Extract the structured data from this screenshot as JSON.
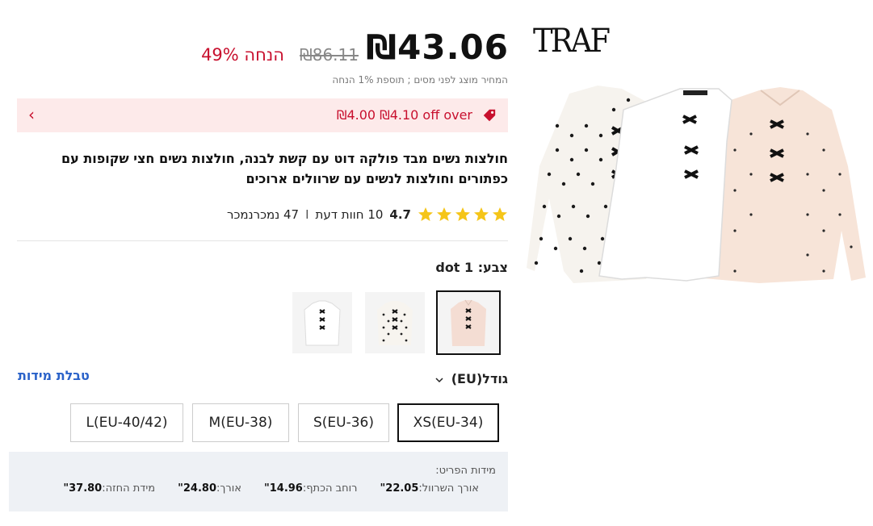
{
  "price": {
    "current": "₪43.06",
    "original": "₪86.11",
    "discount": "49% הנחה",
    "tax_note": "המחיר מוצג לפני מסים ; תוספת 1% הנחה"
  },
  "coupon": {
    "text": "₪4.00 ₪4.10 off over",
    "chevron": "‹"
  },
  "product": {
    "title": "חולצות נשים מבד פולקה דוט עם קשת לבנה, חולצות נשים חצי שקופות עם כפתורים וחולצות לנשים עם שרוולים ארוכים"
  },
  "rating": {
    "score": "4.7",
    "stars": 5,
    "reviews": "10 חוות דעת",
    "sold": "47 נמכרנמכר",
    "separator": "I"
  },
  "color": {
    "label": "צבע:",
    "value": "dot 1",
    "swatches": [
      "dot 1",
      "dot 2",
      "white"
    ]
  },
  "size": {
    "label": "גודל(EU)",
    "chart_link": "טבלת מידות",
    "options": [
      "XS(EU-34)",
      "S(EU-36)",
      "M(EU-38)",
      "L(EU-40/42)"
    ],
    "selected": "XS(EU-34)"
  },
  "measurements": {
    "heading": "מידות הפריט:",
    "items": [
      {
        "label": "מידת החזה:",
        "value": "37.80\""
      },
      {
        "label": "אורך:",
        "value": "24.80\""
      },
      {
        "label": "רוחב הכתף:",
        "value": "14.96\""
      },
      {
        "label": "אורך השרוול:",
        "value": "22.05\""
      }
    ]
  },
  "brand": {
    "logo": "TRAF"
  },
  "colors": {
    "accent_red": "#c8102e",
    "link_blue": "#2a62c9",
    "star_yellow": "#f5c518",
    "coupon_bg": "#fdeaea"
  }
}
